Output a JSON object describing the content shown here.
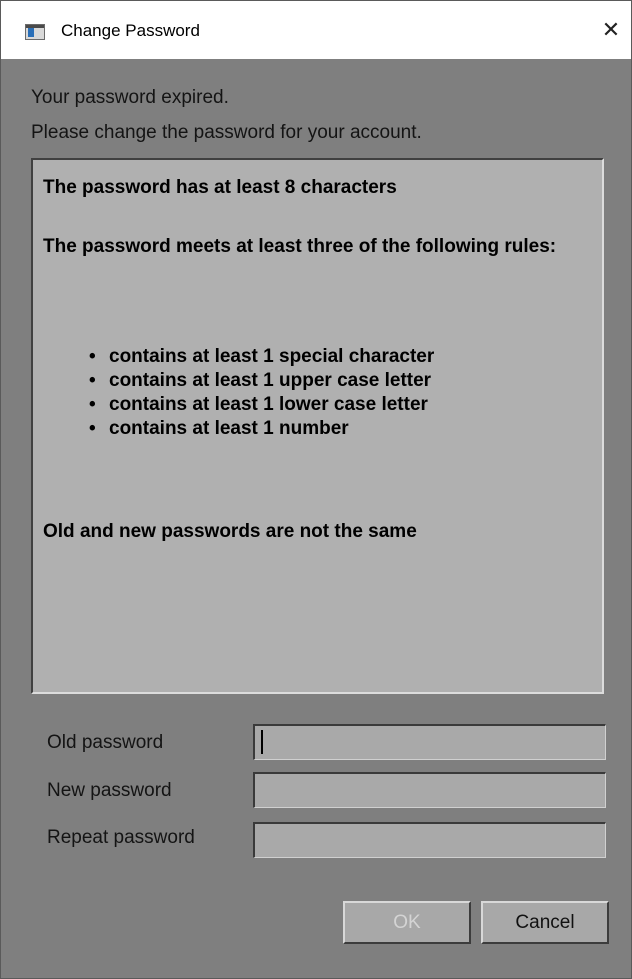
{
  "window": {
    "title": "Change Password",
    "close_glyph": "✕"
  },
  "messages": {
    "line1": "Your password expired.",
    "line2": "Please change the password for your account."
  },
  "rules": {
    "min_length": "The password has at least 8 characters",
    "three_rules": "The password meets at least three of the following rules:",
    "items": [
      "contains at least 1 special character",
      "contains at least 1 upper case letter",
      "contains at least 1 lower case letter",
      "contains at least 1 number"
    ],
    "bullet": "•",
    "not_same": "Old and new passwords are not the same"
  },
  "form": {
    "old_label": "Old password",
    "old_value": "",
    "new_label": "New password",
    "new_value": "",
    "repeat_label": "Repeat password",
    "repeat_value": ""
  },
  "buttons": {
    "ok": "OK",
    "ok_enabled": false,
    "cancel": "Cancel"
  },
  "icons": {
    "app": "app-window-icon",
    "close": "close-icon"
  }
}
